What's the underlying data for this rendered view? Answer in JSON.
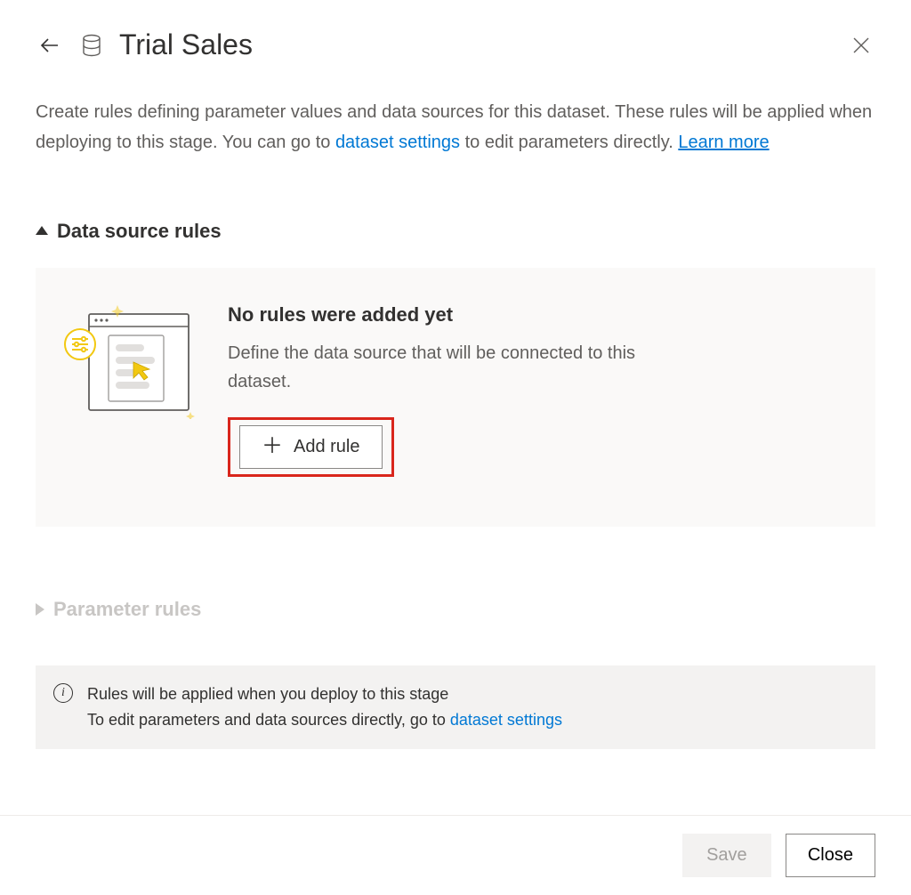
{
  "header": {
    "title": "Trial Sales"
  },
  "intro": {
    "text_before": "Create rules defining parameter values and data sources for this dataset. These rules will be applied when deploying to this stage. You can go to ",
    "dataset_settings_link": "dataset settings",
    "text_mid": " to edit parameters directly. ",
    "learn_more_link": "Learn more"
  },
  "sections": {
    "data_source": {
      "label": "Data source rules",
      "empty_title": "No rules were added yet",
      "empty_text": "Define the data source that will be connected to this dataset.",
      "add_rule_label": "Add rule"
    },
    "parameter": {
      "label": "Parameter rules"
    }
  },
  "infobox": {
    "line1": "Rules will be applied when you deploy to this stage",
    "line2_before": "To edit parameters and data sources directly, go to ",
    "line2_link": "dataset settings"
  },
  "footer": {
    "save_label": "Save",
    "close_label": "Close"
  }
}
